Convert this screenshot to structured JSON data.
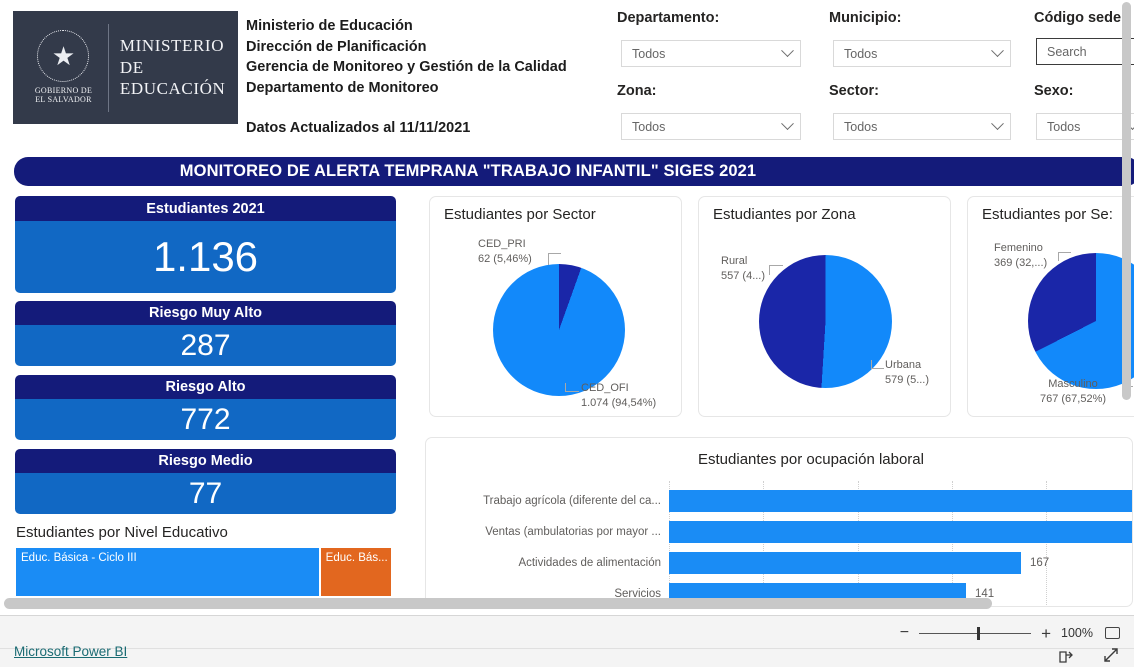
{
  "header": {
    "logo": {
      "crest_alt": "el-salvador-coat-of-arms",
      "gov_line1": "GOBIERNO DE",
      "gov_line2": "EL SALVADOR",
      "name_line1": "MINISTERIO",
      "name_line2": "DE EDUCACIÓN"
    },
    "org_lines": [
      "Ministerio de Educación",
      "Dirección de Planificación",
      "Gerencia de Monitoreo y Gestión de la Calidad",
      "Departamento de Monitoreo"
    ],
    "updated_text": "Datos Actualizados al 11/11/2021"
  },
  "filters": [
    {
      "label": "Departamento:",
      "value": "Todos",
      "type": "dropdown"
    },
    {
      "label": "Municipio:",
      "value": "Todos",
      "type": "dropdown"
    },
    {
      "label": "Código sede",
      "value": "Search",
      "type": "search"
    },
    {
      "label": "Zona:",
      "value": "Todos",
      "type": "dropdown"
    },
    {
      "label": "Sector:",
      "value": "Todos",
      "type": "dropdown"
    },
    {
      "label": "Sexo:",
      "value": "Todos",
      "type": "dropdown"
    }
  ],
  "report_title": "MONITOREO DE ALERTA TEMPRANA \"TRABAJO INFANTIL\" SIGES 2021",
  "kpis": [
    {
      "label": "Estudiantes 2021",
      "value": "1.136"
    },
    {
      "label": "Riesgo Muy Alto",
      "value": "287"
    },
    {
      "label": "Riesgo Alto",
      "value": "772"
    },
    {
      "label": "Riesgo Medio",
      "value": "77"
    }
  ],
  "colors": {
    "navy": "#141b7a",
    "card_blue": "#1168c4",
    "pie_light": "#1289fa",
    "pie_dark": "#1a26a8",
    "bar_blue": "#1a8cf5",
    "treemap_blue": "#1a8cf5",
    "treemap_orange": "#e2671f",
    "link_teal": "#1a6b73"
  },
  "treemap": {
    "title": "Estudiantes por Nivel Educativo",
    "cells": [
      {
        "label": "Educ. Básica - Ciclo III",
        "color": "#1a8cf5",
        "width_pct": 82
      },
      {
        "label": "Educ. Bás...",
        "color": "#e2671f",
        "width_pct": 18
      }
    ]
  },
  "chart_data": [
    {
      "type": "pie",
      "title": "Estudiantes por Sector",
      "categories": [
        "CED_OFI",
        "CED_PRI"
      ],
      "values": [
        1074,
        62
      ],
      "percents": [
        "94,54%",
        "5,46%"
      ],
      "labels": [
        "CED_OFI\n1.074 (94,54%)",
        "CED_PRI\n62 (5,46%)"
      ],
      "label_lines": [
        {
          "l1": "CED_PRI",
          "l2": "62 (5,46%)"
        },
        {
          "l1": "CED_OFI",
          "l2": "1.074 (94,54%)"
        }
      ],
      "colors": [
        "#1289fa",
        "#1a26a8"
      ],
      "legend": "labels-outside"
    },
    {
      "type": "pie",
      "title": "Estudiantes por Zona",
      "categories": [
        "Urbana",
        "Rural"
      ],
      "values": [
        579,
        557
      ],
      "percents": [
        "5...",
        "4..."
      ],
      "label_lines": [
        {
          "l1": "Rural",
          "l2": "557 (4...)"
        },
        {
          "l1": "Urbana",
          "l2": "579 (5...)"
        }
      ],
      "colors": [
        "#1289fa",
        "#1a26a8"
      ],
      "legend": "labels-outside"
    },
    {
      "type": "pie",
      "title": "Estudiantes por Se:",
      "title_full": "Estudiantes por Sexo",
      "categories": [
        "Masculino",
        "Femenino"
      ],
      "values": [
        767,
        369
      ],
      "percents": [
        "67,52%",
        "32,..."
      ],
      "label_lines": [
        {
          "l1": "Femenino",
          "l2": "369 (32,...)"
        },
        {
          "l1": "Masculino",
          "l2": "767 (67,52%)"
        }
      ],
      "colors": [
        "#1289fa",
        "#1a26a8"
      ],
      "legend": "labels-outside"
    },
    {
      "type": "bar",
      "orientation": "horizontal",
      "title": "Estudiantes por ocupación laboral",
      "categories": [
        "Trabajo agrícola (diferente del ca...",
        "Ventas (ambulatorias por mayor ...",
        "Actividades de alimentación",
        "Servicios"
      ],
      "values": [
        null,
        null,
        167,
        141
      ],
      "value_labels": [
        "",
        "",
        "167",
        "141"
      ],
      "xlabel": "",
      "ylabel": "",
      "grid": true
    }
  ],
  "footer": {
    "pbi_label": "Microsoft Power BI",
    "zoom_value": "100%",
    "minus": "−",
    "plus": "+",
    "fit_icon": "fit-to-page-icon",
    "share_icon": "share-icon",
    "fullscreen_icon": "fullscreen-icon"
  }
}
